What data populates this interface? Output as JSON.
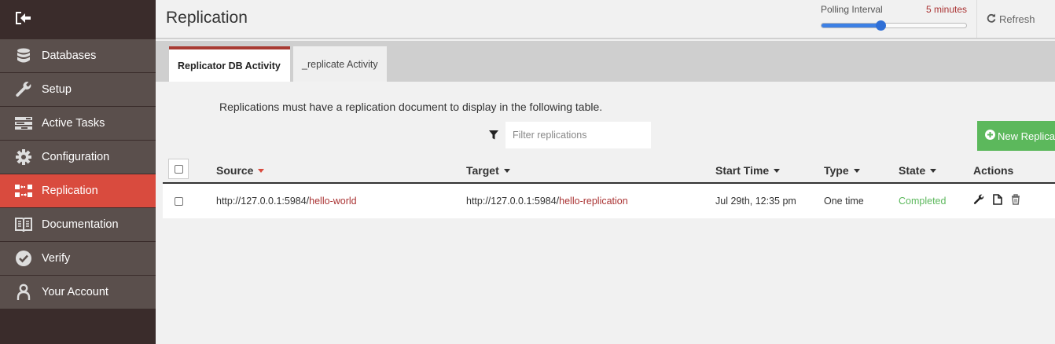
{
  "sidebar": {
    "items": [
      {
        "label": "Databases",
        "icon": "database-icon"
      },
      {
        "label": "Setup",
        "icon": "wrench-icon"
      },
      {
        "label": "Active Tasks",
        "icon": "tasks-icon"
      },
      {
        "label": "Configuration",
        "icon": "gear-icon"
      },
      {
        "label": "Replication",
        "icon": "replication-icon",
        "active": true
      },
      {
        "label": "Documentation",
        "icon": "book-icon"
      },
      {
        "label": "Verify",
        "icon": "check-circle-icon"
      },
      {
        "label": "Your Account",
        "icon": "user-icon"
      }
    ]
  },
  "header": {
    "title": "Replication",
    "polling_label": "Polling Interval",
    "polling_value": "5 minutes",
    "polling_level": 0.41,
    "refresh_label": "Refresh"
  },
  "tabs": [
    {
      "label": "Replicator DB Activity",
      "active": true
    },
    {
      "label": "_replicate Activity",
      "active": false
    }
  ],
  "main": {
    "info": "Replications must have a replication document to display in the following table.",
    "filter_placeholder": "Filter replications",
    "new_button": "New Replicat"
  },
  "table": {
    "headers": {
      "source": "Source",
      "target": "Target",
      "start_time": "Start Time",
      "type": "Type",
      "state": "State",
      "actions": "Actions"
    },
    "rows": [
      {
        "source_host": "http://127.0.0.1:5984/",
        "source_db": "hello-world",
        "target_host": "http://127.0.0.1:5984/",
        "target_db": "hello-replication",
        "start_time": "Jul 29th, 12:35 pm",
        "type": "One time",
        "state": "Completed"
      }
    ]
  },
  "colors": {
    "sidebar_bg": "#5a4f4c",
    "sidebar_dark": "#3a2c2b",
    "active_red": "#d94b3e",
    "link": "#a33333",
    "success": "#5cb85c",
    "slider": "#3d80e4"
  }
}
